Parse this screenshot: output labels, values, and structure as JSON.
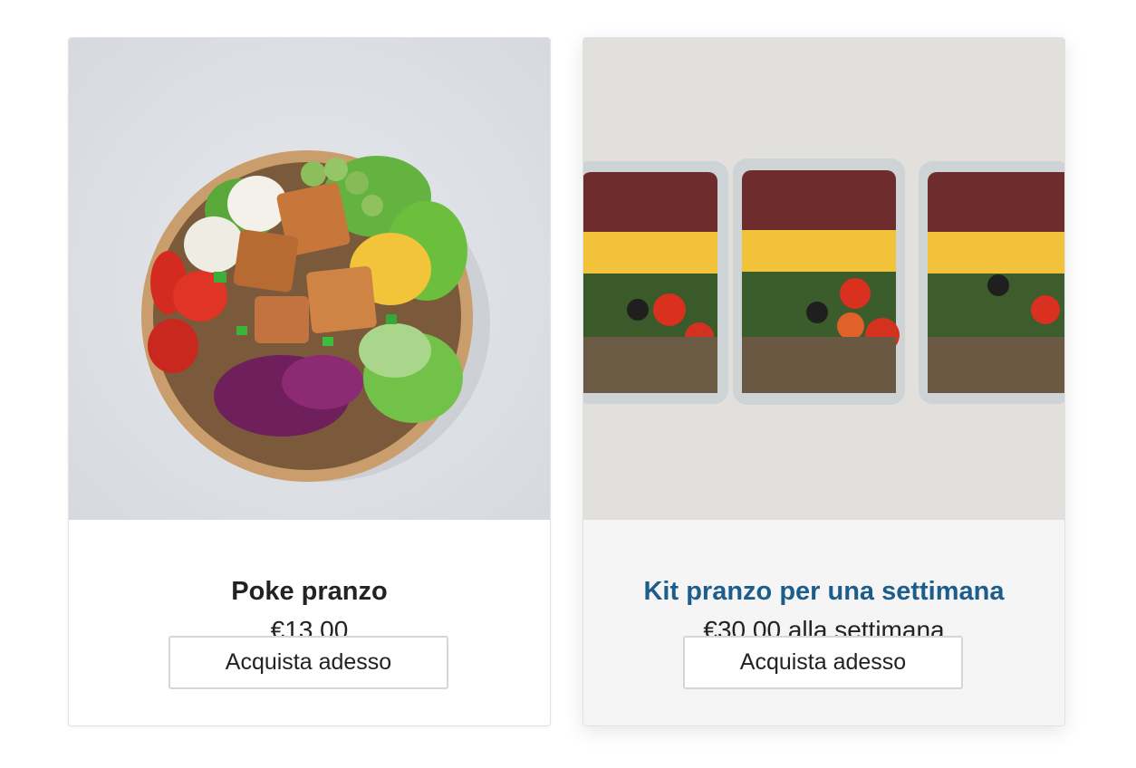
{
  "products": [
    {
      "title": "Poke pranzo",
      "price": "€13,00",
      "button_label": "Acquista adesso",
      "image": "poke-bowl-photo"
    },
    {
      "title": "Kit pranzo per una settimana",
      "price": "€30,00 alla settimana",
      "button_label": "Acquista adesso",
      "image": "meal-prep-containers-photo"
    }
  ],
  "colors": {
    "title_default": "#222222",
    "title_link": "#1d5d8b",
    "card_hover_bg": "#f5f5f5"
  }
}
